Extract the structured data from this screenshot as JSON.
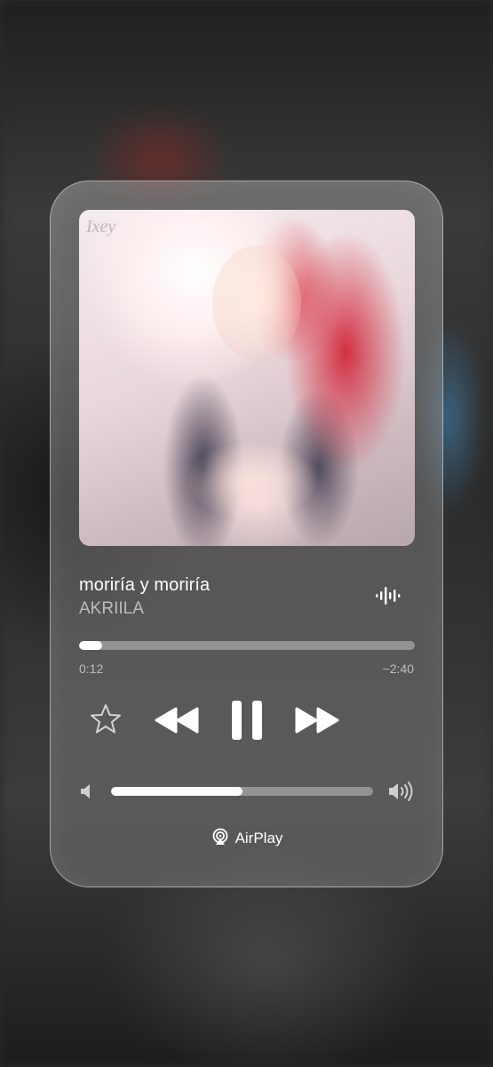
{
  "track": {
    "title": "moriría y moriría",
    "artist": "AKRIILA"
  },
  "artwork": {
    "logo_text": "Ixey"
  },
  "playback": {
    "elapsed": "0:12",
    "remaining": "−2:40",
    "progress_fraction": 0.07
  },
  "volume": {
    "level_fraction": 0.5
  },
  "airplay": {
    "label": "AirPlay"
  },
  "icons": [
    "waveform-icon",
    "star-icon",
    "rewind-icon",
    "pause-icon",
    "forward-icon",
    "volume-low-icon",
    "volume-high-icon",
    "airplay-icon"
  ],
  "colors": {
    "text_primary": "#ffffff",
    "text_secondary": "rgba(255,255,255,0.6)",
    "track_fill": "#ffffff"
  }
}
